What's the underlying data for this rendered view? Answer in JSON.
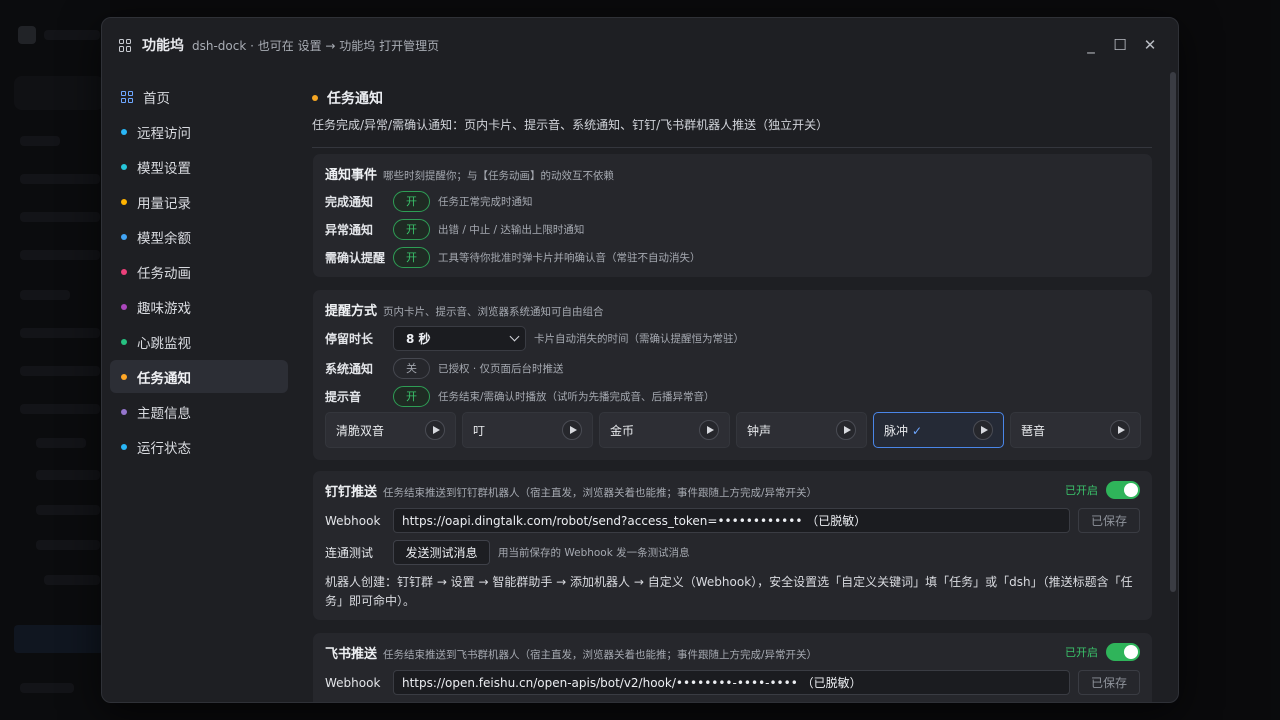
{
  "window": {
    "title": "功能坞",
    "subtitle": "dsh-dock · 也可在 设置 → 功能坞 打开管理页",
    "controls": {
      "minimize": "_",
      "maximize": "☐",
      "close": "✕"
    }
  },
  "sidebar": {
    "items": [
      {
        "label": "首页",
        "icon": "grid-icon",
        "color": "#6ea7ff"
      },
      {
        "label": "远程访问",
        "color": "#29b6f6"
      },
      {
        "label": "模型设置",
        "color": "#26c6da"
      },
      {
        "label": "用量记录",
        "color": "#ffb300"
      },
      {
        "label": "模型余额",
        "color": "#42a5f5"
      },
      {
        "label": "任务动画",
        "color": "#ec407a"
      },
      {
        "label": "趣味游戏",
        "color": "#ab47bc"
      },
      {
        "label": "心跳监视",
        "color": "#26c281"
      },
      {
        "label": "任务通知",
        "color": "#ffa726",
        "active": true
      },
      {
        "label": "主题信息",
        "color": "#9575cd"
      },
      {
        "label": "运行状态",
        "color": "#29b6f6"
      }
    ]
  },
  "section": {
    "title": "任务通知",
    "description": "任务完成/异常/需确认通知：页内卡片、提示音、系统通知、钉钉/飞书群机器人推送（独立开关）"
  },
  "events": {
    "title": "通知事件",
    "subtitle": "哪些时刻提醒你；与【任务动画】的动效互不依赖",
    "rows": [
      {
        "label": "完成通知",
        "state": "开",
        "hint": "任务正常完成时通知"
      },
      {
        "label": "异常通知",
        "state": "开",
        "hint": "出错 / 中止 / 达输出上限时通知"
      },
      {
        "label": "需确认提醒",
        "state": "开",
        "hint": "工具等待你批准时弹卡片并响确认音（常驻不自动消失）"
      }
    ]
  },
  "reminder": {
    "title": "提醒方式",
    "subtitle": "页内卡片、提示音、浏览器系统通知可自由组合",
    "duration": {
      "label": "停留时长",
      "value": "8 秒",
      "hint": "卡片自动消失的时间（需确认提醒恒为常驻）"
    },
    "system": {
      "label": "系统通知",
      "state": "关",
      "hint": "已授权 · 仅页面后台时推送"
    },
    "sound": {
      "label": "提示音",
      "state": "开",
      "hint": "任务结束/需确认时播放（试听为先播完成音、后播异常音）"
    },
    "sounds": [
      {
        "name": "清脆双音"
      },
      {
        "name": "叮"
      },
      {
        "name": "金币"
      },
      {
        "name": "钟声"
      },
      {
        "name": "脉冲",
        "selected": true,
        "check": "✓"
      },
      {
        "name": "琶音"
      }
    ]
  },
  "dingtalk": {
    "title": "钉钉推送",
    "subtitle": "任务结束推送到钉钉群机器人（宿主直发，浏览器关着也能推；事件跟随上方完成/异常开关）",
    "status": "已开启",
    "webhook_label": "Webhook",
    "webhook_value": "https://oapi.dingtalk.com/robot/send?access_token=•••••••••••• （已脱敏）",
    "save_label": "已保存",
    "test_label": "连通测试",
    "test_button": "发送测试消息",
    "test_hint": "用当前保存的 Webhook 发一条测试消息",
    "note": "机器人创建：钉钉群 → 设置 → 智能群助手 → 添加机器人 → 自定义（Webhook），安全设置选「自定义关键词」填「任务」或「dsh」（推送标题含「任务」即可命中）。"
  },
  "feishu": {
    "title": "飞书推送",
    "subtitle": "任务结束推送到飞书群机器人（宿主直发，浏览器关着也能推；事件跟随上方完成/异常开关）",
    "status": "已开启",
    "webhook_label": "Webhook",
    "webhook_value": "https://open.feishu.cn/open-apis/bot/v2/hook/••••••••-••••-•••• （已脱敏）",
    "save_label": "已保存"
  }
}
